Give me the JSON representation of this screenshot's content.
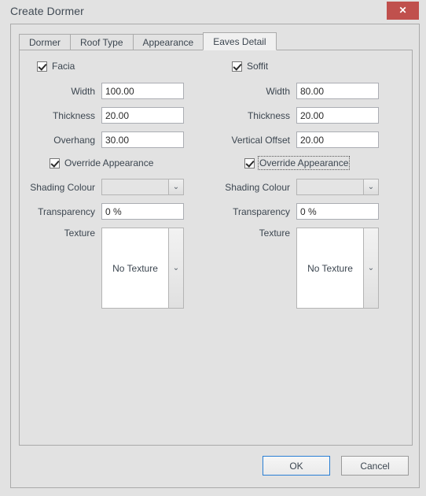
{
  "window": {
    "title": "Create Dormer",
    "close_label": "✕",
    "close_icon": "close-icon",
    "close_color": "#c0504d"
  },
  "tabs": [
    {
      "label": "Dormer",
      "active": false
    },
    {
      "label": "Roof Type",
      "active": false
    },
    {
      "label": "Appearance",
      "active": false
    },
    {
      "label": "Eaves Detail",
      "active": true
    }
  ],
  "facia": {
    "enabled_label": "Facia",
    "enabled": true,
    "fields": [
      {
        "label": "Width",
        "value": "100.00"
      },
      {
        "label": "Thickness",
        "value": "20.00"
      },
      {
        "label": "Overhang",
        "value": "30.00"
      }
    ],
    "override": {
      "label": "Override Appearance",
      "checked": true,
      "focused": false
    },
    "shading_colour": {
      "label": "Shading Colour",
      "value": "",
      "arrow": "⌄"
    },
    "transparency": {
      "label": "Transparency",
      "value": "0 %"
    },
    "texture": {
      "label": "Texture",
      "value": "No Texture",
      "arrow": "⌄"
    }
  },
  "soffit": {
    "enabled_label": "Soffit",
    "enabled": true,
    "fields": [
      {
        "label": "Width",
        "value": "80.00"
      },
      {
        "label": "Thickness",
        "value": "20.00"
      },
      {
        "label": "Vertical Offset",
        "value": "20.00"
      }
    ],
    "override": {
      "label": "Override Appearance",
      "checked": true,
      "focused": true
    },
    "shading_colour": {
      "label": "Shading Colour",
      "value": "",
      "arrow": "⌄"
    },
    "transparency": {
      "label": "Transparency",
      "value": "0 %"
    },
    "texture": {
      "label": "Texture",
      "value": "No Texture",
      "arrow": "⌄"
    }
  },
  "buttons": {
    "ok": "OK",
    "cancel": "Cancel"
  },
  "colors": {
    "dialog_background": "#e2e2e2",
    "panel_background": "#e2e2e2",
    "active_tab_background": "#f0f0f0",
    "border": "#aaaaaa",
    "text": "#3c4650",
    "close_button": "#c0504d",
    "focus_border": "#2a7fd4"
  }
}
